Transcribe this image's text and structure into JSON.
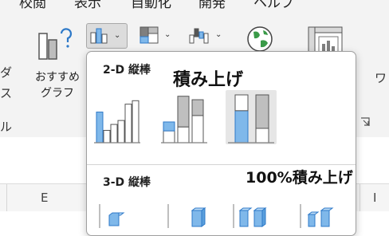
{
  "menu": {
    "items": [
      "校閲",
      "表示",
      "自動化",
      "開発",
      "ヘルプ"
    ]
  },
  "ribbon": {
    "left_fragments": [
      "ダ",
      "ス",
      "ル"
    ],
    "recommended_charts": {
      "line1": "おすすめ",
      "line2": "グラフ"
    },
    "right_fragment": "ワ",
    "chevron": "⌄"
  },
  "gallery": {
    "section_2d": "2-D 縦棒",
    "section_3d": "3-D 縦棒",
    "annotation_stacked": "積み上げ",
    "annotation_100": "100%積み上げ",
    "clustered": {
      "type": "clustered-column",
      "series": [
        {
          "name": "",
          "values": [
            0.62,
            0.37,
            0.78
          ]
        },
        {
          "name": "",
          "values": [
            0.25,
            0.45,
            0.85
          ]
        }
      ]
    },
    "stacked": {
      "type": "stacked-column",
      "series": [
        {
          "name": "",
          "values": [
            0.24,
            0.32,
            0.55
          ]
        },
        {
          "name": "",
          "values": [
            0.18,
            0.62,
            0.32
          ]
        }
      ]
    },
    "stacked100": {
      "type": "100-stacked-column",
      "series": [
        {
          "name": "",
          "values": [
            0.67,
            0.3
          ]
        },
        {
          "name": "",
          "values": [
            0.33,
            0.7
          ]
        }
      ]
    }
  },
  "sheet": {
    "columns": [
      "E",
      "I"
    ]
  },
  "colors": {
    "accent_blue": "#7fb8ea",
    "accent_border": "#2e79c8",
    "gray_fill": "#bfbfbf",
    "ribbon_bg": "#f3f3f3"
  }
}
